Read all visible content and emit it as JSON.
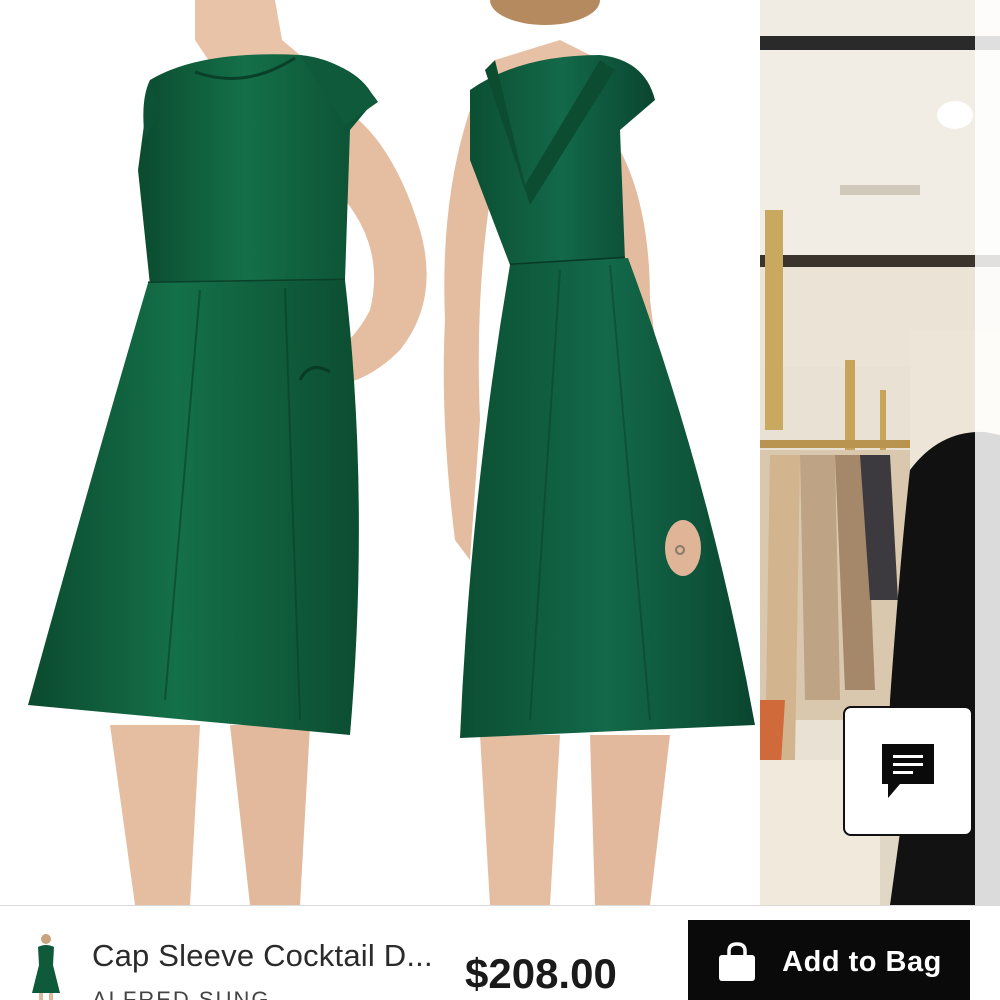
{
  "product": {
    "name": "Cap Sleeve Cocktail D...",
    "brand": "ALFRED SUNG",
    "price": "$208.00",
    "dress_color": "#0f5a3a"
  },
  "actions": {
    "add_to_bag_label": "Add to Bag"
  },
  "icons": {
    "chat": "chat-bubble-icon",
    "bag": "shopping-bag-icon"
  }
}
